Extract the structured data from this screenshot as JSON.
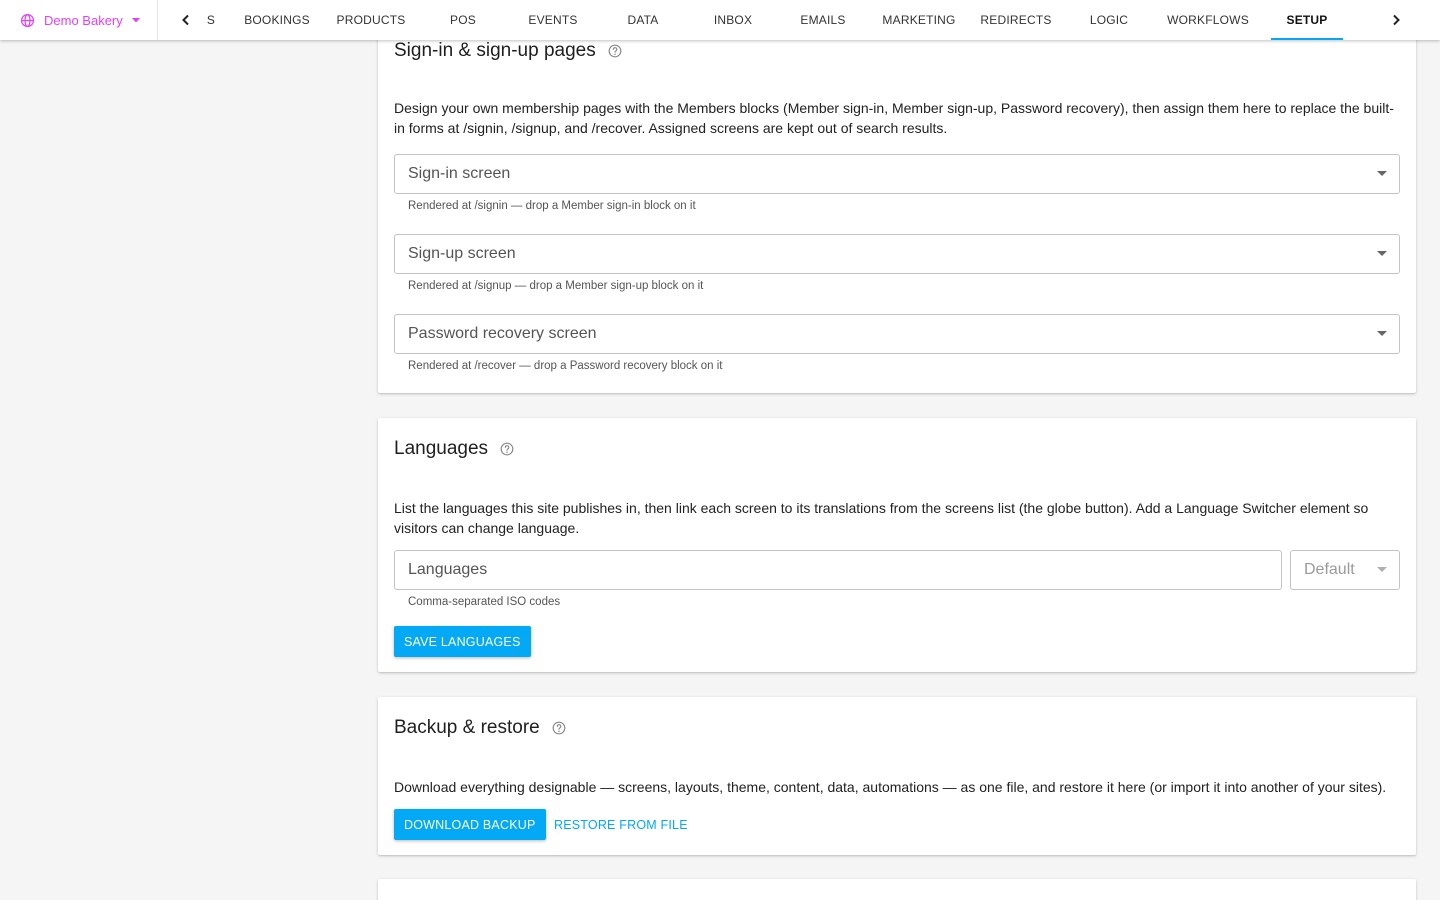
{
  "topbar": {
    "site_name": "Demo Bakery",
    "tabs": [
      {
        "label": "S"
      },
      {
        "label": "BOOKINGS"
      },
      {
        "label": "PRODUCTS"
      },
      {
        "label": "POS"
      },
      {
        "label": "EVENTS"
      },
      {
        "label": "DATA"
      },
      {
        "label": "INBOX"
      },
      {
        "label": "EMAILS"
      },
      {
        "label": "MARKETING"
      },
      {
        "label": "REDIRECTS"
      },
      {
        "label": "LOGIC"
      },
      {
        "label": "WORKFLOWS"
      },
      {
        "label": "SETUP"
      }
    ],
    "active_tab": "SETUP"
  },
  "signin_section": {
    "title": "Sign-in & sign-up pages",
    "description": "Design your own membership pages with the Members blocks (Member sign-in, Member sign-up, Password recovery), then assign them here to replace the built-in forms at /signin, /signup, and /recover. Assigned screens are kept out of search results.",
    "fields": [
      {
        "label": "Sign-in screen",
        "helper": "Rendered at /signin — drop a Member sign-in block on it"
      },
      {
        "label": "Sign-up screen",
        "helper": "Rendered at /signup — drop a Member sign-up block on it"
      },
      {
        "label": "Password recovery screen",
        "helper": "Rendered at /recover — drop a Password recovery block on it"
      }
    ]
  },
  "languages_section": {
    "title": "Languages",
    "description": "List the languages this site publishes in, then link each screen to its translations from the screens list (the globe button). Add a Language Switcher element so visitors can change language.",
    "input_placeholder": "Languages",
    "input_helper": "Comma-separated ISO codes",
    "default_label": "Default",
    "save_label": "SAVE LANGUAGES"
  },
  "backup_section": {
    "title": "Backup & restore",
    "description": "Download everything designable — screens, layouts, theme, content, data, automations — as one file, and restore it here (or import it into another of your sites).",
    "download_label": "DOWNLOAD BACKUP",
    "restore_label": "RESTORE FROM FILE"
  },
  "colors": {
    "accent": "#03a9f4",
    "brand": "#e040fb",
    "background": "#f5f5f5"
  },
  "icons": {
    "site": "globe-icon",
    "help": "help-circle-icon",
    "prev": "chevron-left-icon",
    "next": "chevron-right-icon",
    "dropdown": "caret-down-icon"
  }
}
